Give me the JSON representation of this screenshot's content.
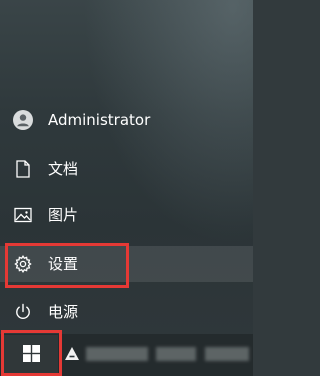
{
  "start_menu": {
    "items": [
      {
        "id": "user",
        "label": "Administrator",
        "icon": "user-avatar-icon"
      },
      {
        "id": "documents",
        "label": "文档",
        "icon": "document-icon"
      },
      {
        "id": "pictures",
        "label": "图片",
        "icon": "image-icon"
      },
      {
        "id": "settings",
        "label": "设置",
        "icon": "gear-icon"
      },
      {
        "id": "power",
        "label": "电源",
        "icon": "power-icon"
      }
    ]
  },
  "taskbar": {
    "start_icon": "windows-logo-icon",
    "pinned_icon": "app-icon"
  },
  "colors": {
    "highlight": "#e53935",
    "text": "#ffffff"
  }
}
